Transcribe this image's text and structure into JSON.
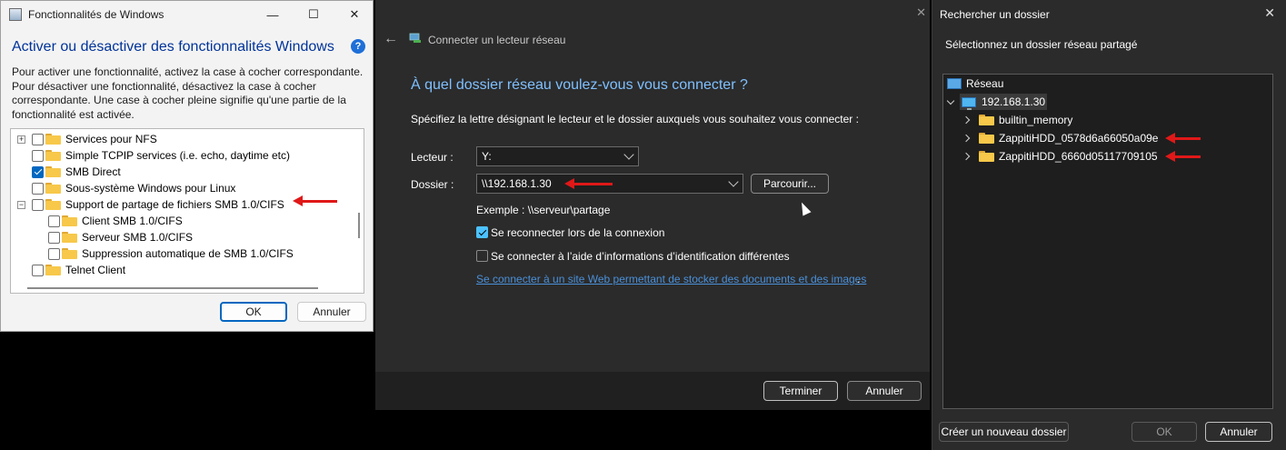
{
  "features_window": {
    "title": "Fonctionnalités de Windows",
    "heading": "Activer ou désactiver des fonctionnalités Windows",
    "help": "?",
    "description": "Pour activer une fonctionnalité, activez la case à cocher correspondante. Pour désactiver une fonctionnalité, désactivez la case à cocher correspondante. Une case à cocher pleine signifie qu'une partie de la fonctionnalité est activée.",
    "items": [
      {
        "label": "Services pour NFS",
        "checked": false,
        "expander": "+"
      },
      {
        "label": "Simple TCPIP services (i.e. echo, daytime etc)",
        "checked": false,
        "expander": ""
      },
      {
        "label": "SMB Direct",
        "checked": true,
        "expander": ""
      },
      {
        "label": "Sous-système Windows pour Linux",
        "checked": false,
        "expander": ""
      },
      {
        "label": "Support de partage de fichiers SMB 1.0/CIFS",
        "checked": false,
        "expander": "−"
      },
      {
        "label": "Client SMB 1.0/CIFS",
        "checked": false,
        "expander": ""
      },
      {
        "label": "Serveur SMB 1.0/CIFS",
        "checked": false,
        "expander": ""
      },
      {
        "label": "Suppression automatique de SMB 1.0/CIFS",
        "checked": false,
        "expander": ""
      },
      {
        "label": "Telnet Client",
        "checked": false,
        "expander": ""
      }
    ],
    "ok_label": "OK",
    "cancel_label": "Annuler",
    "close_glyph": "✕",
    "max_glyph": "☐",
    "min_glyph": "—"
  },
  "map_drive_window": {
    "title": "Connecter un lecteur réseau",
    "heading": "À quel dossier réseau voulez-vous vous connecter ?",
    "instructions": "Spécifiez la lettre désignant le lecteur et le dossier auxquels vous souhaitez vous connecter :",
    "drive_label": "Lecteur :",
    "drive_value": "Y:",
    "folder_label": "Dossier :",
    "folder_value": "\\\\192.168.1.30",
    "browse_label": "Parcourir...",
    "example": "Exemple : \\\\serveur\\partage",
    "reconnect_label": "Se reconnecter lors de la connexion",
    "reconnect_checked": true,
    "other_credentials_label": "Se connecter à l’aide d’informations d’identification différentes",
    "other_credentials_checked": false,
    "link_text": "Se connecter à un site Web permettant de stocker des documents et des images",
    "link_suffix": ".",
    "finish_label": "Terminer",
    "cancel_label": "Annuler",
    "close_glyph": "✕",
    "back_glyph": "←"
  },
  "browse_window": {
    "title": "Rechercher un dossier",
    "prompt": "Sélectionnez un dossier réseau partagé",
    "tree": {
      "root": "Réseau",
      "host": "192.168.1.30",
      "folders": [
        "builtin_memory",
        "ZappitiHDD_0578d6a66050a09e",
        "ZappitiHDD_6660d05117709105"
      ]
    },
    "new_folder_label": "Créer un nouveau dossier",
    "ok_label": "OK",
    "cancel_label": "Annuler",
    "close_glyph": "✕"
  },
  "colors": {
    "accent_light": "#0067c0",
    "accent_dark": "#4cc2ff",
    "heading_blue": "#003399",
    "annotation_red": "#e01818"
  }
}
